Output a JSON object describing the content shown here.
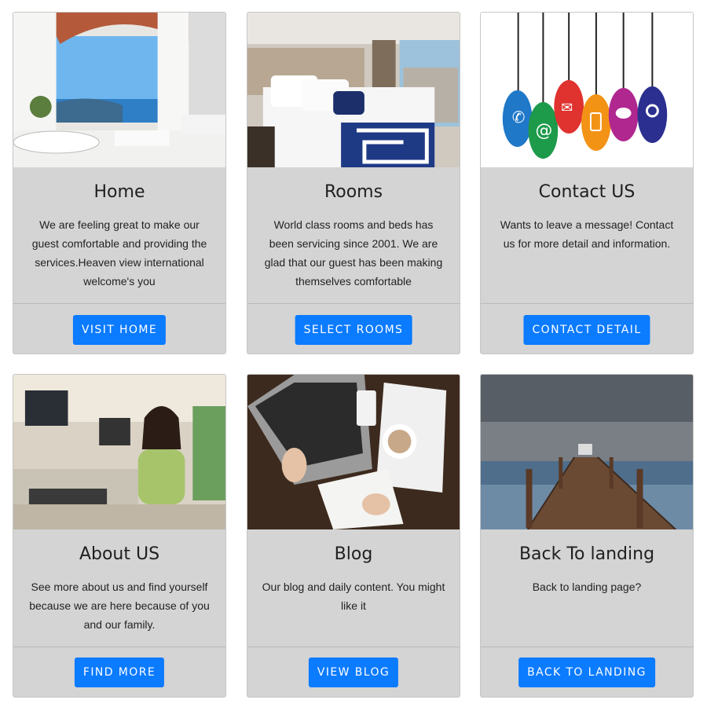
{
  "cards": [
    {
      "image": "balcony-sea-view",
      "title": "Home",
      "text": "We are feeling great to make our guest comfortable and providing the services.Heaven view international welcome's you",
      "button": "VISIT HOME"
    },
    {
      "image": "hotel-bedroom",
      "title": "Rooms",
      "text": "World class rooms and beds has been servicing since 2001. We are glad that our guest has been making themselves comfortable",
      "button": "SELECT ROOMS"
    },
    {
      "image": "contact-icons-tags",
      "title": "Contact US",
      "text": "Wants to leave a message! Contact us for more detail and information.",
      "button": "CONTACT DETAIL"
    },
    {
      "image": "shop-cashier",
      "title": "About US",
      "text": "See more about us and find yourself because we are here because of you and our family.",
      "button": "FIND MORE"
    },
    {
      "image": "desk-laptop-coffee",
      "title": "Blog",
      "text": "Our blog and daily content. You might like it",
      "button": "VIEW BLOG"
    },
    {
      "image": "pier-sea",
      "title": "Back To landing",
      "text": "Back to landing page?",
      "button": "BACK TO LANDING"
    }
  ],
  "colors": {
    "card_bg": "#d4d4d4",
    "button_bg": "#0b7bff",
    "button_text": "#ffffff"
  }
}
